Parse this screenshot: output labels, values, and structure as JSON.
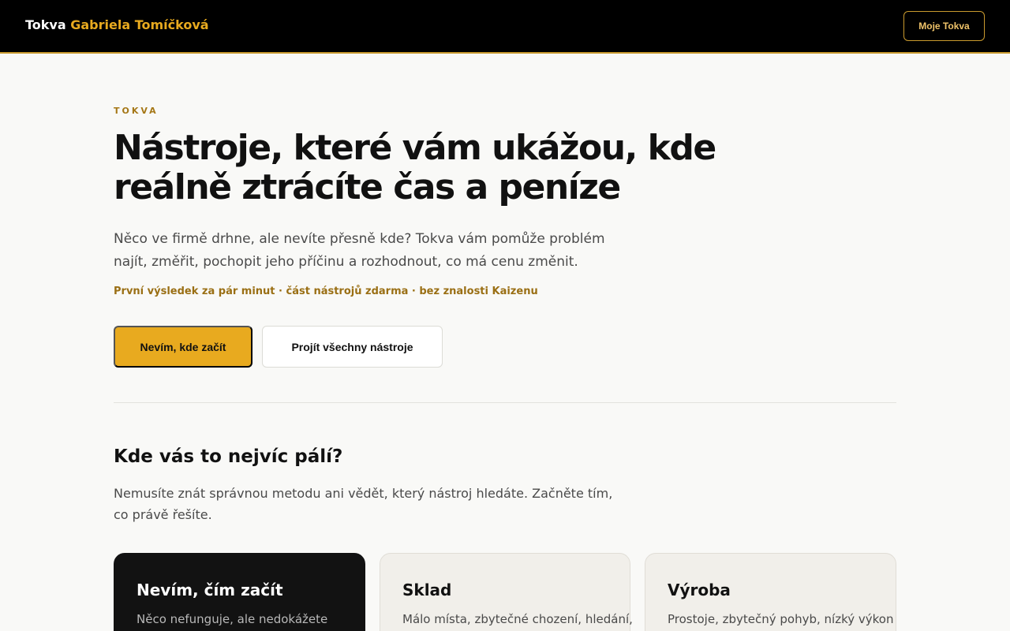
{
  "header": {
    "brand_prefix": "Tokva",
    "brand_owner": "Gabriela Tomíčková",
    "account_button": "Moje Tokva"
  },
  "hero": {
    "eyebrow": "TOKVA",
    "title": "Nástroje, které vám ukážou, kde reálně ztrácíte čas a peníze",
    "subtitle": "Něco ve firmě drhne, ale nevíte přesně kde? Tokva vám pomůže problém najít, změřit, pochopit jeho příčinu a rozhodnout, co má cenu změnit.",
    "note": "První výsledek za pár minut · část nástrojů zdarma · bez znalosti Kaizenu",
    "primary_button": "Nevím, kde začít",
    "secondary_button": "Projít všechny nástroje"
  },
  "section": {
    "title": "Kde vás to nejvíc pálí?",
    "subtitle": "Nemusíte znát správnou metodu ani vědět, který nástroj hledáte. Začněte tím, co právě řešíte."
  },
  "cards": [
    {
      "title": "Nevím, čím začít",
      "desc": "Něco nefunguje, ale nedokážete"
    },
    {
      "title": "Sklad",
      "desc": "Málo místa, zbytečné chození, hledání,"
    },
    {
      "title": "Výroba",
      "desc": "Prostoje, zbytečný pohyb, nízký výkon"
    }
  ],
  "colors": {
    "accent": "#e8aa1f",
    "header_bg": "#000000",
    "page_bg": "#f9f9f7",
    "dark_card": "#121212",
    "light_card": "#f1efea"
  }
}
